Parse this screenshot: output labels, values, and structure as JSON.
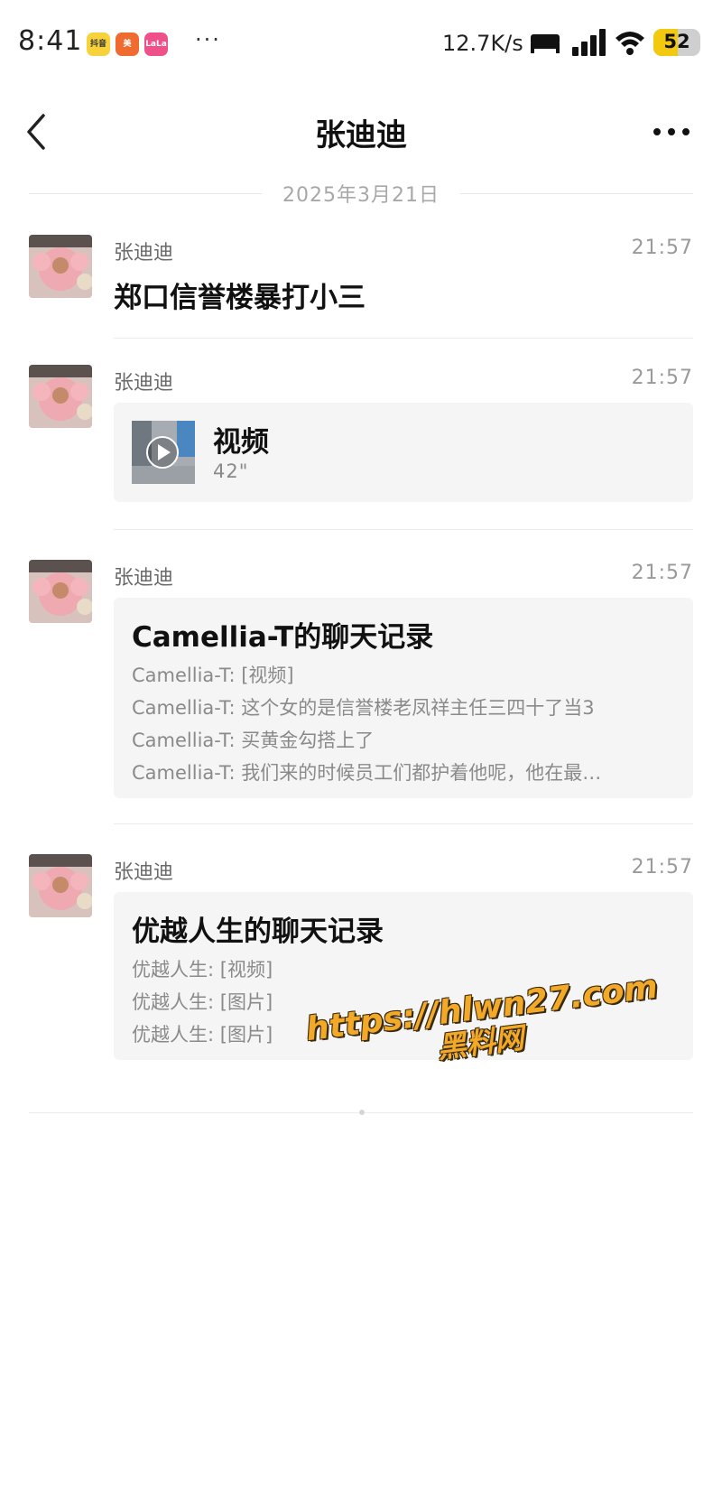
{
  "status_bar": {
    "time": "8:41",
    "app_icons": [
      {
        "name": "pinduoduo-icon",
        "label": "抖音",
        "color": "#f7d23b"
      },
      {
        "name": "meituan-icon",
        "label": "美",
        "color": "#f06b30"
      },
      {
        "name": "lofter-icon",
        "label": "LaLa",
        "color": "#f0508a"
      }
    ],
    "more": "···",
    "net_speed": "12.7K/s",
    "battery": "52",
    "battery_level": 0.52
  },
  "header": {
    "back_icon": "chevron-left-icon",
    "title": "张迪迪",
    "more_icon": "more-horizontal-icon"
  },
  "date_divider": "2025年3月21日",
  "messages": [
    {
      "sender": "张迪迪",
      "time": "21:57",
      "text": "郑口信誉楼暴打小三"
    },
    {
      "sender": "张迪迪",
      "time": "21:57",
      "video": {
        "title": "视频",
        "duration": "42\""
      }
    },
    {
      "sender": "张迪迪",
      "time": "21:57",
      "record": {
        "title": "Camellia-T的聊天记录",
        "lines": [
          "Camellia-T: [视频]",
          "Camellia-T: 这个女的是信誉楼老凤祥主任三四十了当3",
          "Camellia-T: 买黄金勾搭上了",
          "Camellia-T: 我们来的时候员工们都护着他呢，他在最…"
        ]
      }
    },
    {
      "sender": "张迪迪",
      "time": "21:57",
      "record": {
        "title": "优越人生的聊天记录",
        "lines": [
          "优越人生: [视频]",
          "优越人生: [图片]",
          "优越人生: [图片]"
        ]
      }
    }
  ],
  "watermark": {
    "url": "https://hlwn27.com",
    "name": "黑料网"
  },
  "colors": {
    "card_bg": "#f5f5f5",
    "watermark": "#f3a928",
    "battery": "#f2c90f"
  }
}
